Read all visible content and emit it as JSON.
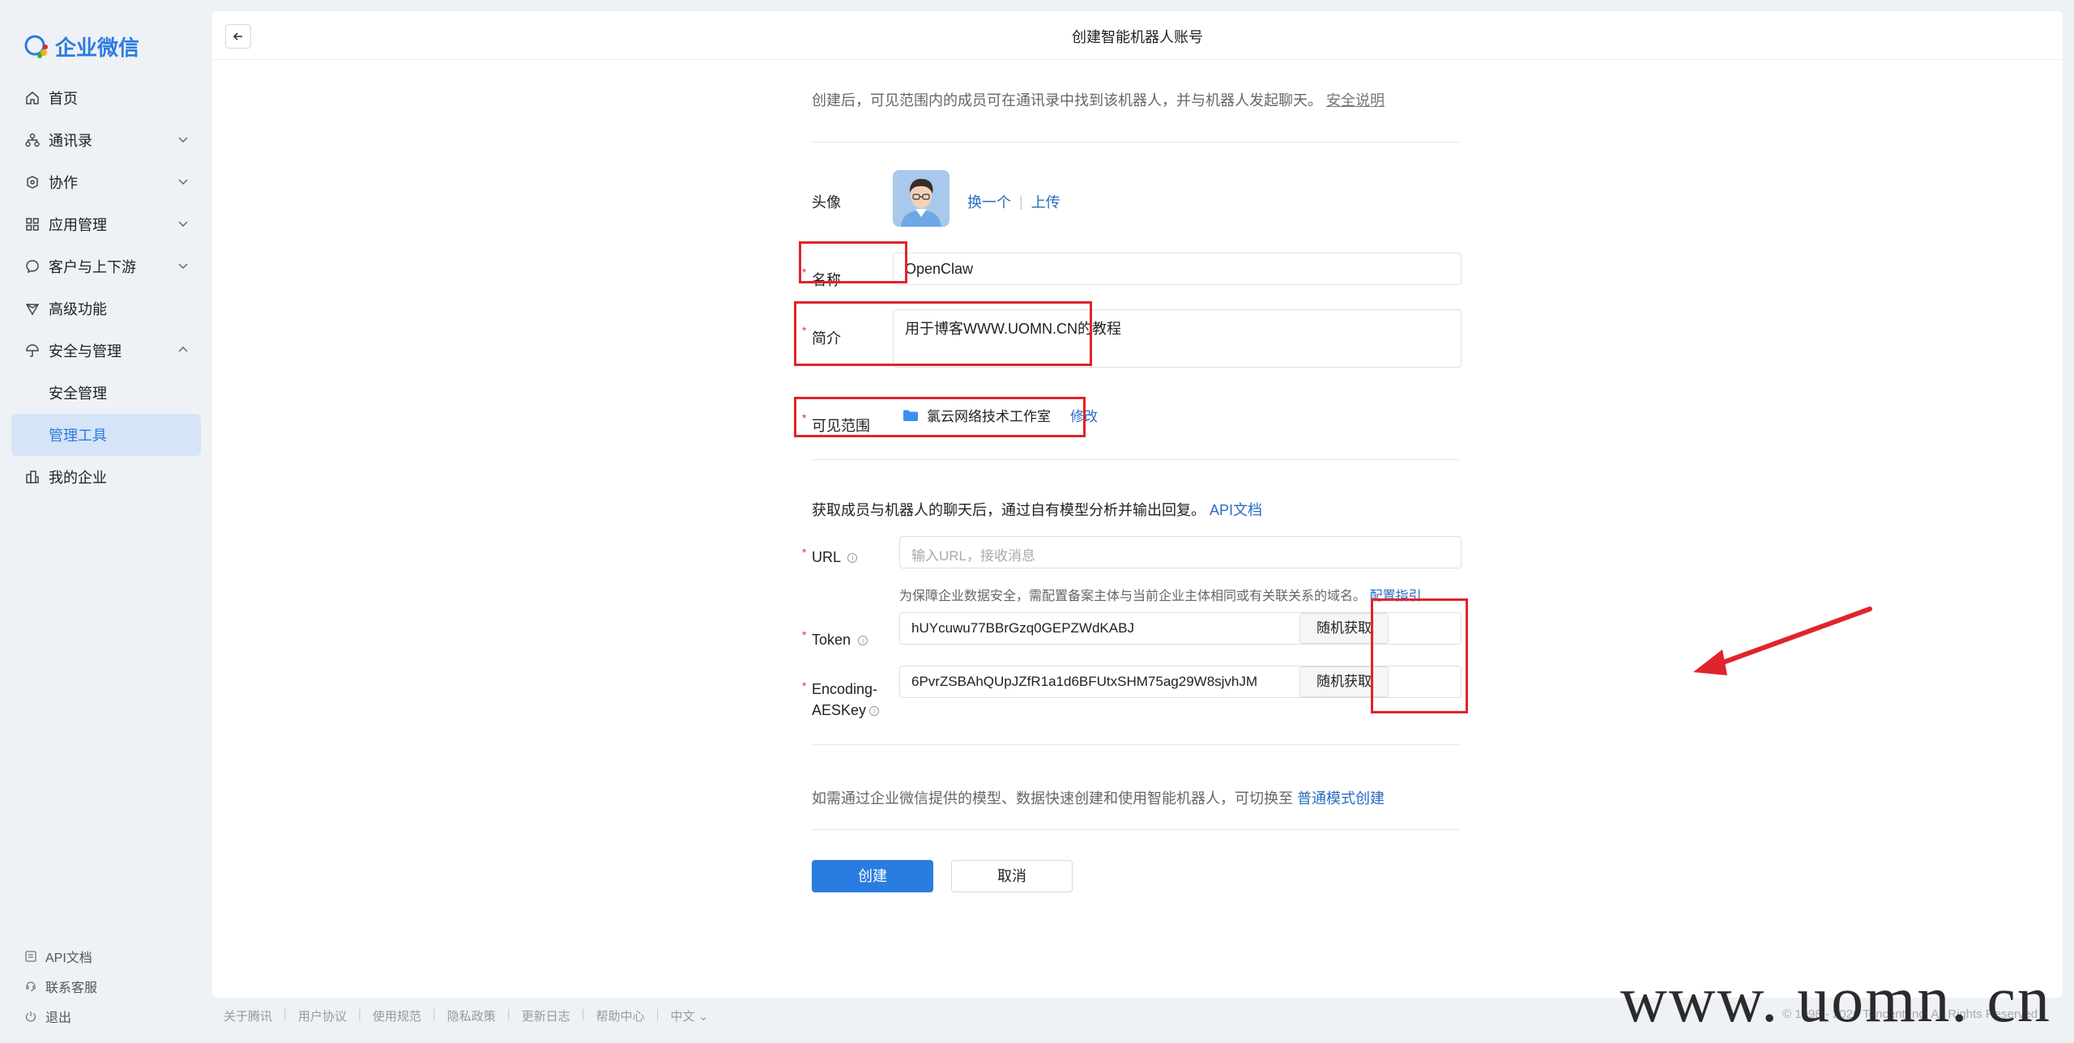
{
  "app": {
    "name": "企业微信",
    "brand_color": "#2a7ce0"
  },
  "sidebar": {
    "items": [
      {
        "label": "首页",
        "icon": "home-icon"
      },
      {
        "label": "通讯录",
        "icon": "org-icon",
        "expandable": true
      },
      {
        "label": "协作",
        "icon": "collab-icon",
        "expandable": true
      },
      {
        "label": "应用管理",
        "icon": "apps-icon",
        "expandable": true
      },
      {
        "label": "客户与上下游",
        "icon": "chat-icon",
        "expandable": true
      },
      {
        "label": "高级功能",
        "icon": "diamond-icon"
      },
      {
        "label": "安全与管理",
        "icon": "umbrella-icon",
        "expanded": true
      },
      {
        "label": "安全管理",
        "sub": true
      },
      {
        "label": "管理工具",
        "sub": true,
        "active": true
      },
      {
        "label": "我的企业",
        "icon": "company-icon"
      }
    ],
    "bottom": [
      {
        "label": "API文档",
        "icon": "doc-icon"
      },
      {
        "label": "联系客服",
        "icon": "service-icon"
      },
      {
        "label": "退出",
        "icon": "power-icon"
      }
    ]
  },
  "header": {
    "title": "创建智能机器人账号"
  },
  "form": {
    "intro": "创建后，可见范围内的成员可在通讯录中找到该机器人，并与机器人发起聊天。",
    "intro_link": "安全说明",
    "avatar_label": "头像",
    "avatar_change": "换一个",
    "avatar_upload": "上传",
    "name_label": "名称",
    "name_value": "OpenClaw",
    "intro_label": "简介",
    "intro_value": "用于博客WWW.UOMN.CN的教程",
    "scope_label": "可见范围",
    "scope_value": "氯云网络技术工作室",
    "scope_edit": "修改",
    "api_desc": "获取成员与机器人的聊天后，通过自有模型分析并输出回复。",
    "api_link": "API文档",
    "url_label": "URL",
    "url_placeholder": "输入URL，接收消息",
    "url_hint": "为保障企业数据安全，需配置备案主体与当前企业主体相同或有关联关系的域名。",
    "url_hint_link": "配置指引",
    "token_label": "Token",
    "token_value": "hUYcuwu77BBrGzq0GEPZWdKABJ",
    "token_button": "随机获取",
    "aes_label_1": "Encoding-",
    "aes_label_2": "AESKey",
    "aes_value": "6PvrZSBAhQUpJZfR1a1d6BFUtxSHM75ag29W8sjvhJM",
    "aes_button": "随机获取",
    "switch_note": "如需通过企业微信提供的模型、数据快速创建和使用智能机器人，可切换至",
    "switch_link": "普通模式创建",
    "create_button": "创建",
    "cancel_button": "取消"
  },
  "footer": {
    "links": [
      "关于腾讯",
      "用户协议",
      "使用规范",
      "隐私政策",
      "更新日志",
      "帮助中心",
      "中文"
    ],
    "copyright": "© 1998 - 2026 Tencent Inc. All Rights Reserved"
  },
  "watermark": "www. uomn. cn",
  "annotation_color": "#e0242b"
}
